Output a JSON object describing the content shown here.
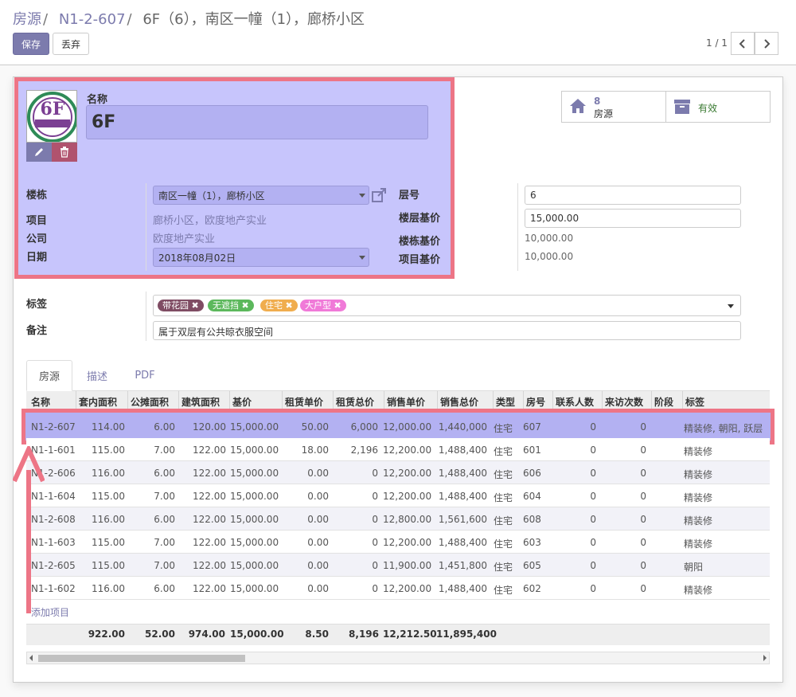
{
  "breadcrumb": {
    "crumb1": "房源",
    "crumb2": "N1-2-607",
    "current": "6F（6），南区一幢（1），廊桥小区"
  },
  "toolbar": {
    "save": "保存",
    "discard": "丢弃"
  },
  "pager": {
    "value": "1 / 1"
  },
  "smart_buttons": {
    "rooms_count": "8",
    "rooms_label": "房源",
    "active_label": "有效"
  },
  "avatar": {
    "text": "6F"
  },
  "form": {
    "name_label": "名称",
    "name_value": "6F",
    "building_label": "楼栋",
    "building_value": "南区一幢（1），廊桥小区",
    "project_label": "项目",
    "project_value": "廊桥小区，欧度地产实业",
    "company_label": "公司",
    "company_value": "欧度地产实业",
    "date_label": "日期",
    "date_value": "2018年08月02日",
    "floor_label": "层号",
    "floor_value": "6",
    "floor_base_label": "楼层基价",
    "floor_base_value": "15,000.00",
    "building_base_label": "楼栋基价",
    "building_base_value": "10,000.00",
    "project_base_label": "项目基价",
    "project_base_value": "10,000.00",
    "tags_label": "标签",
    "note_label": "备注",
    "note_value": "属于双层有公共晾衣服空间"
  },
  "tags": [
    {
      "label": "带花园",
      "color": "#7f4c63"
    },
    {
      "label": "无遮挡",
      "color": "#5cb85c"
    },
    {
      "label": "住宅",
      "color": "#f0ad4e"
    },
    {
      "label": "大户型",
      "color": "#f07ad8"
    }
  ],
  "tabs": [
    "房源",
    "描述",
    "PDF"
  ],
  "table": {
    "columns": [
      "名称",
      "套内面积",
      "公摊面积",
      "建筑面积",
      "基价",
      "租赁单价",
      "租赁总价",
      "销售单价",
      "销售总价",
      "类型",
      "房号",
      "联系人数",
      "来访次数",
      "阶段",
      "标签"
    ],
    "rows": [
      [
        "N1-2-607",
        "114.00",
        "6.00",
        "120.00",
        "15,000.00",
        "50.00",
        "6,000",
        "12,000.00",
        "1,440,000",
        "住宅",
        "607",
        "0",
        "0",
        "",
        "精装修, 朝阳, 跃层"
      ],
      [
        "N1-1-601",
        "115.00",
        "7.00",
        "122.00",
        "15,000.00",
        "18.00",
        "2,196",
        "12,200.00",
        "1,488,400",
        "住宅",
        "601",
        "0",
        "0",
        "",
        "精装修"
      ],
      [
        "N1-2-606",
        "116.00",
        "6.00",
        "122.00",
        "15,000.00",
        "0.00",
        "0",
        "12,200.00",
        "1,488,400",
        "住宅",
        "606",
        "0",
        "0",
        "",
        "精装修"
      ],
      [
        "N1-1-604",
        "115.00",
        "7.00",
        "122.00",
        "15,000.00",
        "0.00",
        "0",
        "12,200.00",
        "1,488,400",
        "住宅",
        "604",
        "0",
        "0",
        "",
        "精装修"
      ],
      [
        "N1-2-608",
        "116.00",
        "6.00",
        "122.00",
        "15,000.00",
        "0.00",
        "0",
        "12,800.00",
        "1,561,600",
        "住宅",
        "608",
        "0",
        "0",
        "",
        "精装修"
      ],
      [
        "N1-1-603",
        "115.00",
        "7.00",
        "122.00",
        "15,000.00",
        "0.00",
        "0",
        "12,200.00",
        "1,488,400",
        "住宅",
        "603",
        "0",
        "0",
        "",
        "精装修"
      ],
      [
        "N1-2-605",
        "115.00",
        "7.00",
        "122.00",
        "15,000.00",
        "0.00",
        "0",
        "11,900.00",
        "1,451,800",
        "住宅",
        "605",
        "0",
        "0",
        "",
        "朝阳"
      ],
      [
        "N1-1-602",
        "116.00",
        "6.00",
        "122.00",
        "15,000.00",
        "0.00",
        "0",
        "12,200.00",
        "1,488,400",
        "住宅",
        "602",
        "0",
        "0",
        "",
        "精装修"
      ]
    ],
    "add_item": "添加项目",
    "totals": [
      "922.00",
      "52.00",
      "974.00",
      "15,000.00",
      "8.50",
      "8,196",
      "12,212.50",
      "11,895,400"
    ]
  },
  "colors": {
    "brand": "#7c7bad",
    "highlight_fill": "#c7c5fc",
    "highlight_border": "#ed7586"
  }
}
